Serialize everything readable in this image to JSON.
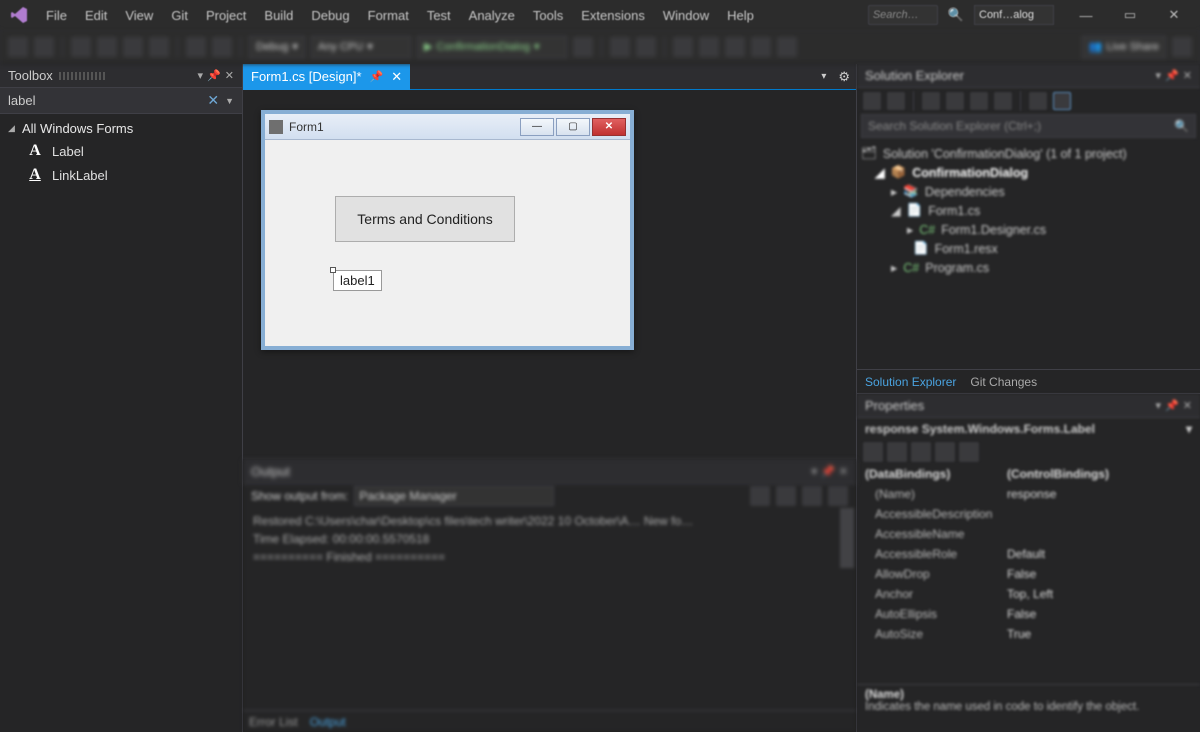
{
  "titlebar": {
    "menus": [
      "File",
      "Edit",
      "View",
      "Git",
      "Project",
      "Build",
      "Debug",
      "Format",
      "Test",
      "Analyze",
      "Tools",
      "Extensions",
      "Window",
      "Help"
    ],
    "search_placeholder": "Search…",
    "project_badge": "Conf…alog"
  },
  "toolbar": {
    "config": "Debug",
    "platform": "Any CPU",
    "start_target": "ConfirmationDialog",
    "live_share": "Live Share"
  },
  "toolbox": {
    "title": "Toolbox",
    "filter": "label",
    "group": "All Windows Forms",
    "items": [
      "Label",
      "LinkLabel"
    ]
  },
  "tab": {
    "title": "Form1.cs [Design]*"
  },
  "form": {
    "title": "Form1",
    "button_text": "Terms and Conditions",
    "label_text": "label1"
  },
  "output": {
    "title": "Output",
    "show_from_label": "Show output from:",
    "show_from_value": "Package Manager",
    "lines": [
      "Restored C:\\Users\\char\\Desktop\\cs files\\tech writer\\2022 10 October\\A… New fo…",
      "Time Elapsed: 00:00:00.5570518",
      "========== Finished =========="
    ],
    "tabs": {
      "error_list": "Error List",
      "output": "Output"
    }
  },
  "solution": {
    "title": "Solution Explorer",
    "search_placeholder": "Search Solution Explorer (Ctrl+;)",
    "root": "Solution 'ConfirmationDialog' (1 of 1 project)",
    "project": "ConfirmationDialog",
    "nodes": {
      "deps": "Dependencies",
      "form": "Form1.cs",
      "form_designer": "Form1.Designer.cs",
      "form_resx": "Form1.resx",
      "program": "Program.cs"
    },
    "tabs": {
      "soln": "Solution Explorer",
      "git": "Git Changes"
    }
  },
  "properties": {
    "title": "Properties",
    "selected": "response System.Windows.Forms.Label",
    "rows": [
      {
        "k": "(DataBindings)",
        "v": "(ControlBindings)",
        "grp": true
      },
      {
        "k": "(Name)",
        "v": "response"
      },
      {
        "k": "AccessibleDescription",
        "v": ""
      },
      {
        "k": "AccessibleName",
        "v": ""
      },
      {
        "k": "AccessibleRole",
        "v": "Default"
      },
      {
        "k": "AllowDrop",
        "v": "False"
      },
      {
        "k": "Anchor",
        "v": "Top, Left"
      },
      {
        "k": "AutoEllipsis",
        "v": "False"
      },
      {
        "k": "AutoSize",
        "v": "True"
      }
    ],
    "desc_title": "(Name)",
    "desc_text": "Indicates the name used in code to identify the object."
  }
}
